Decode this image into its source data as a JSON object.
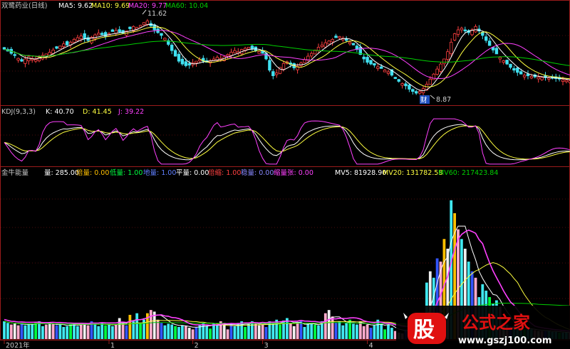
{
  "colors": {
    "bg": "#000000",
    "frame": "#9a1b1b",
    "grid": "#5a1010",
    "up": "#ff4040",
    "down": "#40e0f0",
    "ma5": "#ffffff",
    "ma10": "#ffff40",
    "ma20": "#ff40ff",
    "ma60": "#00d000",
    "label": "#c8c8c8",
    "vol_pink": "#ffaacc",
    "vol_yellow": "#ffc000",
    "vol_green": "#00ff40",
    "vol_cyan": "#40e8f0",
    "vol_blue": "#3355ff",
    "vol_white": "#f0f0f0",
    "watermark_red": "#e01010",
    "watermark_white": "#ffffff"
  },
  "price_header": {
    "title": "双鹭药业(日线)",
    "ma5": "MA5: 9.62",
    "ma10": "MA10: 9.69",
    "ma20": "MA20: 9.77",
    "ma60": "MA60: 10.04"
  },
  "kdj_header": {
    "title": "KDJ(9,3,3)",
    "k": "K: 40.70",
    "d": "D: 41.45",
    "j": "J: 39.22"
  },
  "vol_header": {
    "title": "金牛能量",
    "liang": "量: 285.00",
    "beiliang": "倍量: 0.00",
    "diliang": "低量: 1.00",
    "diliang2": "地量: 1.00",
    "pingliang": "平量: 0.00",
    "beisuo": "倍缩: 1.00",
    "wenliang": "稳量: 0.00",
    "suoliangzhang": "缩量张: 0.00",
    "mv5": "MV5: 81928.90",
    "mv20": "MV20: 131782.58",
    "mv60": "MV60: 217423.84"
  },
  "annotations": {
    "high": "11.62",
    "low": "8.87",
    "low_badge": "财"
  },
  "x_axis": {
    "ticks": [
      {
        "label": "2021年",
        "day": 0
      },
      {
        "label": "1",
        "day": 30
      },
      {
        "label": "2",
        "day": 54
      },
      {
        "label": "3",
        "day": 74
      },
      {
        "label": "4",
        "day": 104
      }
    ]
  },
  "watermark": {
    "logo_char": "股",
    "text": "公式之家",
    "url": "www.gszj100.com"
  },
  "chart_data": [
    {
      "type": "candlestick",
      "title": "双鹭药业(日线)",
      "ylim": [
        8.6,
        11.9
      ],
      "days": 163,
      "annotated_high": 11.62,
      "annotated_low": 8.87,
      "closes": [
        10.55,
        10.48,
        10.4,
        10.32,
        10.22,
        10.12,
        10.2,
        10.28,
        10.22,
        10.18,
        10.26,
        10.33,
        10.38,
        10.44,
        10.52,
        10.58,
        10.66,
        10.74,
        10.7,
        10.8,
        10.9,
        10.96,
        11.02,
        10.92,
        10.86,
        10.98,
        11.06,
        11.12,
        11.06,
        11.01,
        11.1,
        11.18,
        11.22,
        11.16,
        11.12,
        11.2,
        11.28,
        11.36,
        11.32,
        11.4,
        11.5,
        11.56,
        11.38,
        11.24,
        11.14,
        11.04,
        10.94,
        10.72,
        10.5,
        10.3,
        10.12,
        10.02,
        9.96,
        9.98,
        10.06,
        10.12,
        10.18,
        10.12,
        10.08,
        10.14,
        10.2,
        10.26,
        10.22,
        10.28,
        10.36,
        10.44,
        10.5,
        10.46,
        10.54,
        10.58,
        10.62,
        10.56,
        10.5,
        10.46,
        10.4,
        10.2,
        9.8,
        9.6,
        9.7,
        9.9,
        10.04,
        10.1,
        10.0,
        9.88,
        9.94,
        10.06,
        10.18,
        10.3,
        10.4,
        10.52,
        10.62,
        10.7,
        10.78,
        10.84,
        10.9,
        10.96,
        11.0,
        10.94,
        10.86,
        10.8,
        10.7,
        10.54,
        10.36,
        10.2,
        10.08,
        10.02,
        9.98,
        9.92,
        9.86,
        9.8,
        9.74,
        9.62,
        9.5,
        9.4,
        9.32,
        9.24,
        9.12,
        9.04,
        8.98,
        9.04,
        9.14,
        9.3,
        9.48,
        9.66,
        9.84,
        10.02,
        10.2,
        10.46,
        10.8,
        11.1,
        11.24,
        11.3,
        11.2,
        11.14,
        11.24,
        11.36,
        11.2,
        11.04,
        10.86,
        10.68,
        10.52,
        10.38,
        10.26,
        10.14,
        10.02,
        9.9,
        9.8,
        9.72,
        9.66,
        9.62,
        9.6,
        9.58,
        9.56,
        9.55,
        9.54,
        9.53,
        9.52,
        9.51,
        9.5,
        9.48,
        9.46,
        9.44,
        9.42
      ]
    },
    {
      "type": "line",
      "title": "KDJ(9,3,3)",
      "ylim": [
        -5,
        110
      ],
      "series_keys": [
        "K",
        "D",
        "J"
      ]
    },
    {
      "type": "bar",
      "title": "金牛能量",
      "ylim": [
        0,
        1000
      ],
      "values": [
        110,
        100,
        90,
        95,
        85,
        100,
        85,
        90,
        95,
        100,
        110,
        80,
        90,
        100,
        95,
        85,
        90,
        75,
        80,
        95,
        100,
        80,
        90,
        95,
        85,
        110,
        90,
        80,
        100,
        85,
        95,
        80,
        90,
        130,
        100,
        85,
        150,
        110,
        160,
        95,
        120,
        160,
        180,
        170,
        120,
        100,
        85,
        95,
        90,
        80,
        75,
        85,
        80,
        70,
        60,
        75,
        90,
        100,
        80,
        65,
        95,
        85,
        110,
        100,
        60,
        95,
        80,
        100,
        110,
        75,
        95,
        110,
        100,
        85,
        90,
        75,
        110,
        100,
        120,
        90,
        115,
        130,
        95,
        80,
        100,
        110,
        75,
        95,
        100,
        90,
        85,
        110,
        160,
        180,
        140,
        100,
        110,
        85,
        100,
        120,
        95,
        90,
        110,
        80,
        90,
        70,
        85,
        120,
        95,
        60,
        90,
        70,
        50,
        40,
        35,
        60,
        80,
        60,
        50,
        70,
        90,
        350,
        420,
        380,
        500,
        480,
        620,
        560,
        860,
        780,
        680,
        620,
        560,
        480,
        420,
        380,
        260,
        340,
        300,
        260,
        220,
        240,
        200,
        100,
        90,
        80,
        80,
        70,
        70,
        60,
        60,
        60,
        55,
        50,
        50,
        50,
        50,
        45,
        45,
        40,
        40,
        40,
        40
      ],
      "special_bars": [
        {
          "day": 129,
          "value": 860,
          "color": "yellow"
        },
        {
          "day": 126,
          "value": 620,
          "color": "yellow"
        },
        {
          "day": 103,
          "value": 180,
          "color": "pink"
        },
        {
          "day": 41,
          "value": 180,
          "color": "yellow"
        },
        {
          "day": 36,
          "value": 150,
          "color": "yellow"
        }
      ]
    }
  ]
}
